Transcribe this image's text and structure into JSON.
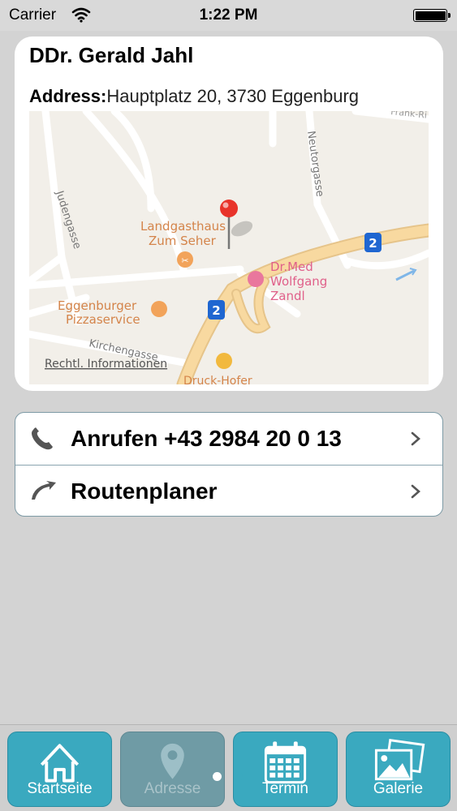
{
  "status_bar": {
    "carrier": "Carrier",
    "time": "1:22 PM"
  },
  "detail": {
    "name": "DDr. Gerald Jahl",
    "address_label": "Address:",
    "address_value": "Hauptplatz 20, 3730 Eggenburg"
  },
  "map": {
    "labels": {
      "landgasthaus_1": "Landgasthaus",
      "landgasthaus_2": "Zum Seher",
      "eggenburger_1": "Eggenburger",
      "eggenburger_2": "Pizzaservice",
      "drmed_1": "Dr.Med",
      "drmed_2": "Wolfgang",
      "drmed_3": "Zandl",
      "neutorgasse": "Neutorgasse",
      "judengasse": "Judengasse",
      "kirchengasse": "Kirchengasse",
      "druck_hofer": "Druck-Hofer",
      "frank_ring": "Frank-Ri",
      "legal": "Rechtl. Informationen",
      "route_badge": "2"
    },
    "colors": {
      "road_main": "#f8d9a0",
      "road_minor": "#ffffff",
      "badge": "#1f66d1",
      "pin": "#e8332a"
    }
  },
  "actions": [
    {
      "label": "Anrufen +43 2984 20 0 13",
      "icon": "phone-icon"
    },
    {
      "label": "Routenplaner",
      "icon": "route-icon"
    }
  ],
  "tabs": [
    {
      "label": "Startseite",
      "icon": "home-icon"
    },
    {
      "label": "Adresse",
      "icon": "map-pin-icon"
    },
    {
      "label": "Termin",
      "icon": "calendar-icon"
    },
    {
      "label": "Galerie",
      "icon": "gallery-icon"
    }
  ],
  "colors": {
    "tab_active": "#3aa9bf",
    "tab_current": "#6f9ba5",
    "background": "#d3d3d3"
  }
}
